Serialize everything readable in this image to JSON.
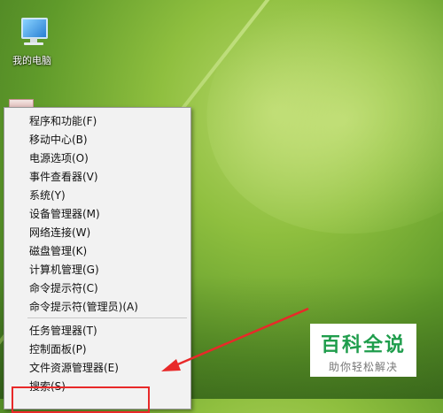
{
  "desktop": {
    "icons": [
      {
        "label": "我的电脑",
        "icon": "computer-icon"
      }
    ]
  },
  "context_menu": {
    "groups": [
      {
        "items": [
          {
            "label": "程序和功能(F)"
          },
          {
            "label": "移动中心(B)"
          },
          {
            "label": "电源选项(O)"
          },
          {
            "label": "事件查看器(V)"
          },
          {
            "label": "系统(Y)"
          },
          {
            "label": "设备管理器(M)"
          },
          {
            "label": "网络连接(W)"
          },
          {
            "label": "磁盘管理(K)"
          },
          {
            "label": "计算机管理(G)"
          },
          {
            "label": "命令提示符(C)"
          },
          {
            "label": "命令提示符(管理员)(A)"
          }
        ]
      },
      {
        "items": [
          {
            "label": "任务管理器(T)"
          },
          {
            "label": "控制面板(P)"
          },
          {
            "label": "文件资源管理器(E)"
          },
          {
            "label": "搜索(S)"
          }
        ]
      }
    ]
  },
  "annotation": {
    "color": "#e82929"
  },
  "watermark": {
    "title": "百科全说",
    "subtitle": "助你轻松解决",
    "title_color": "#1f9d4c"
  }
}
